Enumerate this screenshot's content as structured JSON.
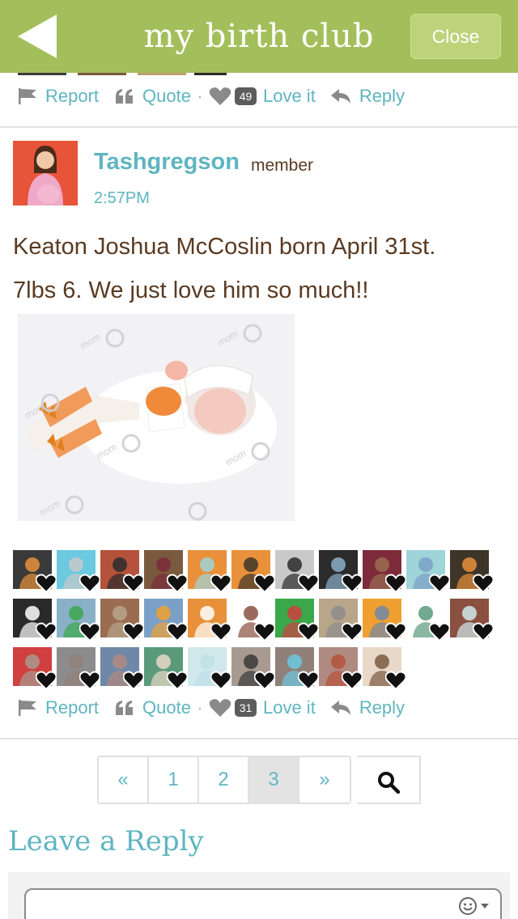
{
  "header": {
    "title": "my birth club",
    "close_label": "Close"
  },
  "prev_post_actions": {
    "report": "Report",
    "quote": "Quote",
    "separator": "·",
    "love_count": "49",
    "love": "Love it",
    "reply": "Reply"
  },
  "post": {
    "username": "Tashgregson",
    "role": "member",
    "time": "2:57PM",
    "body_line1": "Keaton Joshua McCoslin born April 31st.",
    "body_line2": "7lbs 6. We just love him so much!!",
    "photo_watermark": "mom",
    "actions": {
      "report": "Report",
      "quote": "Quote",
      "separator": "·",
      "love_count": "31",
      "love": "Love it",
      "reply": "Reply"
    }
  },
  "lovers": {
    "count": 31,
    "swatches": [
      "#3a3a3a",
      "#6cc9e0",
      "#b5523c",
      "#7a5a3e",
      "#e8913a",
      "#e8913a",
      "#c9c9c9",
      "#2b2b2b",
      "#7d2b3a",
      "#9fd4d8",
      "#3d3528",
      "#2a2a2a",
      "#8ab0c8",
      "#9a6d52",
      "#7aa0c8",
      "#e8913a",
      "#ffffff",
      "#3aa84a",
      "#b8a58a",
      "#f0a030",
      "#ffffff",
      "#8a5040",
      "#d04040",
      "#8c8c8c",
      "#7088a8",
      "#5a9a7a",
      "#d0e8ec",
      "#a89a90",
      "#90807a",
      "#b08a80",
      "#e8d8c8",
      "#bfe0e8"
    ]
  },
  "pagination": {
    "prev": "«",
    "pages": [
      "1",
      "2",
      "3"
    ],
    "active": "3",
    "next": "»"
  },
  "reply_section": {
    "title": "Leave a Reply"
  },
  "colors": {
    "header_green": "#a3bf5b",
    "accent_teal": "#5fb5c0",
    "text_brown": "#5a3a22",
    "divider": "#e3e3e3"
  }
}
